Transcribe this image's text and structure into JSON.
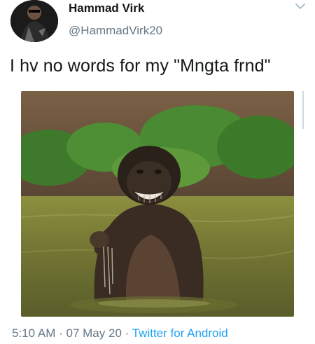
{
  "user": {
    "display_name": "Hammad Virk",
    "handle": "@HammadVirk20",
    "avatar_icon": "avatar"
  },
  "tweet": {
    "text": "I hv no words for my \"Mngta frnd\"",
    "image_icon": "bonobo-photo"
  },
  "meta": {
    "time": "5:10 AM",
    "separator": "·",
    "date": "07 May 20",
    "source": "Twitter for Android"
  },
  "menu_icon": "chevron-down-icon",
  "colors": {
    "text": "#14171a",
    "muted": "#657786",
    "link": "#1da1f2"
  }
}
